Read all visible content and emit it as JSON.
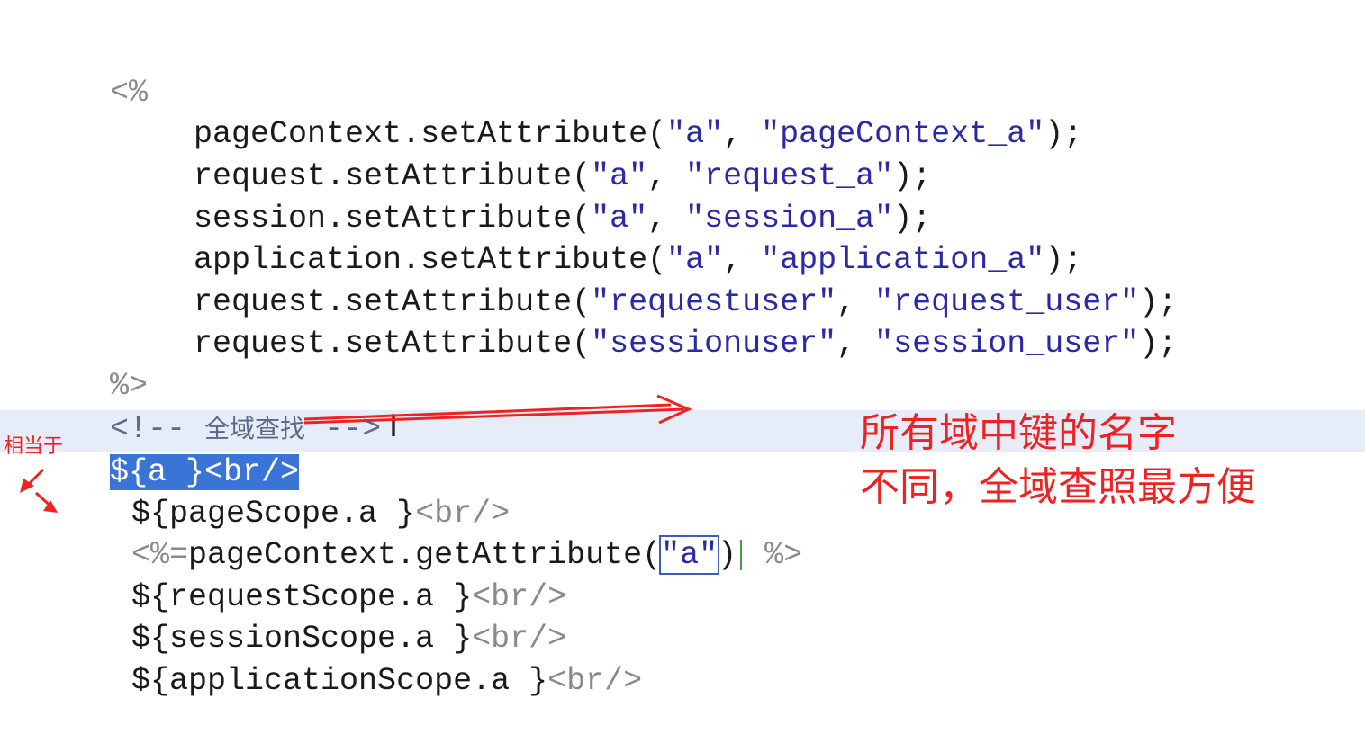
{
  "code": {
    "open_tag": "<%",
    "close_tag": "%>",
    "lines": [
      {
        "obj": "pageContext",
        "method": ".setAttribute(",
        "key": "\"a\"",
        "sep": ", ",
        "val": "\"pageContext_a\"",
        "end": ");"
      },
      {
        "obj": "request",
        "method": ".setAttribute(",
        "key": "\"a\"",
        "sep": ", ",
        "val": "\"request_a\"",
        "end": ");"
      },
      {
        "obj": "session",
        "method": ".setAttribute(",
        "key": "\"a\"",
        "sep": ", ",
        "val": "\"session_a\"",
        "end": ");"
      },
      {
        "obj": "application",
        "method": ".setAttribute(",
        "key": "\"a\"",
        "sep": ", ",
        "val": "\"application_a\"",
        "end": ");"
      },
      {
        "obj": "request",
        "method": ".setAttribute(",
        "key": "\"requestuser\"",
        "sep": ", ",
        "val": "\"request_user\"",
        "end": ");"
      },
      {
        "obj": "request",
        "method": ".setAttribute(",
        "key": "\"sessionuser\"",
        "sep": ", ",
        "val": "\"session_user\"",
        "end": ");"
      }
    ],
    "comment_open": "<!-- ",
    "comment_text": "全域查找",
    "comment_close": " -->",
    "el_a": "${a }",
    "br": "<br/>",
    "el_page": "${pageScope.a }",
    "jsp_expr_open": "<%=",
    "jsp_expr_call": "pageContext.getAttribute(",
    "jsp_expr_arg": "\"a\"",
    "jsp_expr_close_paren": ")",
    "jsp_expr_end": " %>",
    "el_request": "${requestScope.a }",
    "el_session": "${sessionScope.a }",
    "el_application": "${applicationScope.a }"
  },
  "annotations": {
    "equivalent_label": "相当于",
    "note_line1": "所有域中键的名字",
    "note_line2": "不同，全域查照最方便",
    "color": "#ee2222"
  }
}
